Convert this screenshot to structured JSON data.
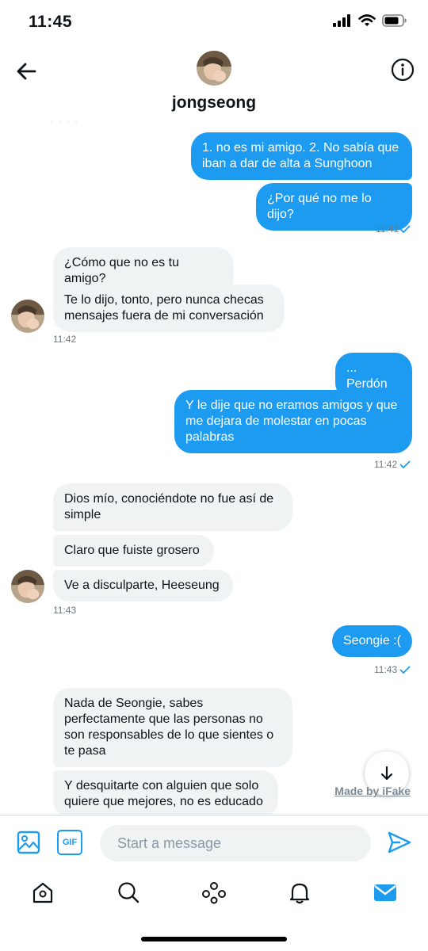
{
  "status": {
    "time": "11:45"
  },
  "header": {
    "name": "jongseong"
  },
  "messages": {
    "out1": {
      "text": "1. no es mi amigo. 2. No sabía que iban a dar de alta a Sunghoon"
    },
    "out2": {
      "text": "¿Por qué no me lo dijo?"
    },
    "time1": "11:41",
    "in1": {
      "text": "¿Cómo que no es tu amigo?"
    },
    "in2": {
      "text": "Te lo dijo, tonto, pero nunca checas mensajes fuera de mi conversación"
    },
    "time2": "11:42",
    "out3": {
      "text": "... Perdón"
    },
    "out4": {
      "text": "Y le dije que no eramos amigos y que me dejara de molestar en pocas palabras"
    },
    "time3": "11:42",
    "in3": {
      "text": "Dios mío, conociéndote no fue así de simple"
    },
    "in4": {
      "text": "Claro que fuiste grosero"
    },
    "in5": {
      "text": "Ve a disculparte, Heeseung"
    },
    "time4": "11:43",
    "out5": {
      "text": "Seongie :("
    },
    "time5": "11:43",
    "in6": {
      "text": "Nada de Seongie, sabes perfectamente que las personas no son responsables de lo que sientes o te pasa"
    },
    "in7": {
      "text": "Y desquitarte con alguien que solo quiere que mejores, no es educado"
    }
  },
  "watermark": "Made by iFake",
  "composer": {
    "placeholder": "Start a message",
    "gif_label": "GIF"
  },
  "colors": {
    "accent": "#1d9bf0",
    "incoming_bubble": "#eff3f4"
  },
  "icons": {
    "back": "arrow-left-icon",
    "info": "info-icon",
    "image": "image-icon",
    "send": "send-icon",
    "tabs": [
      "home-icon",
      "search-icon",
      "spaces-icon",
      "bell-icon",
      "mail-icon"
    ]
  }
}
